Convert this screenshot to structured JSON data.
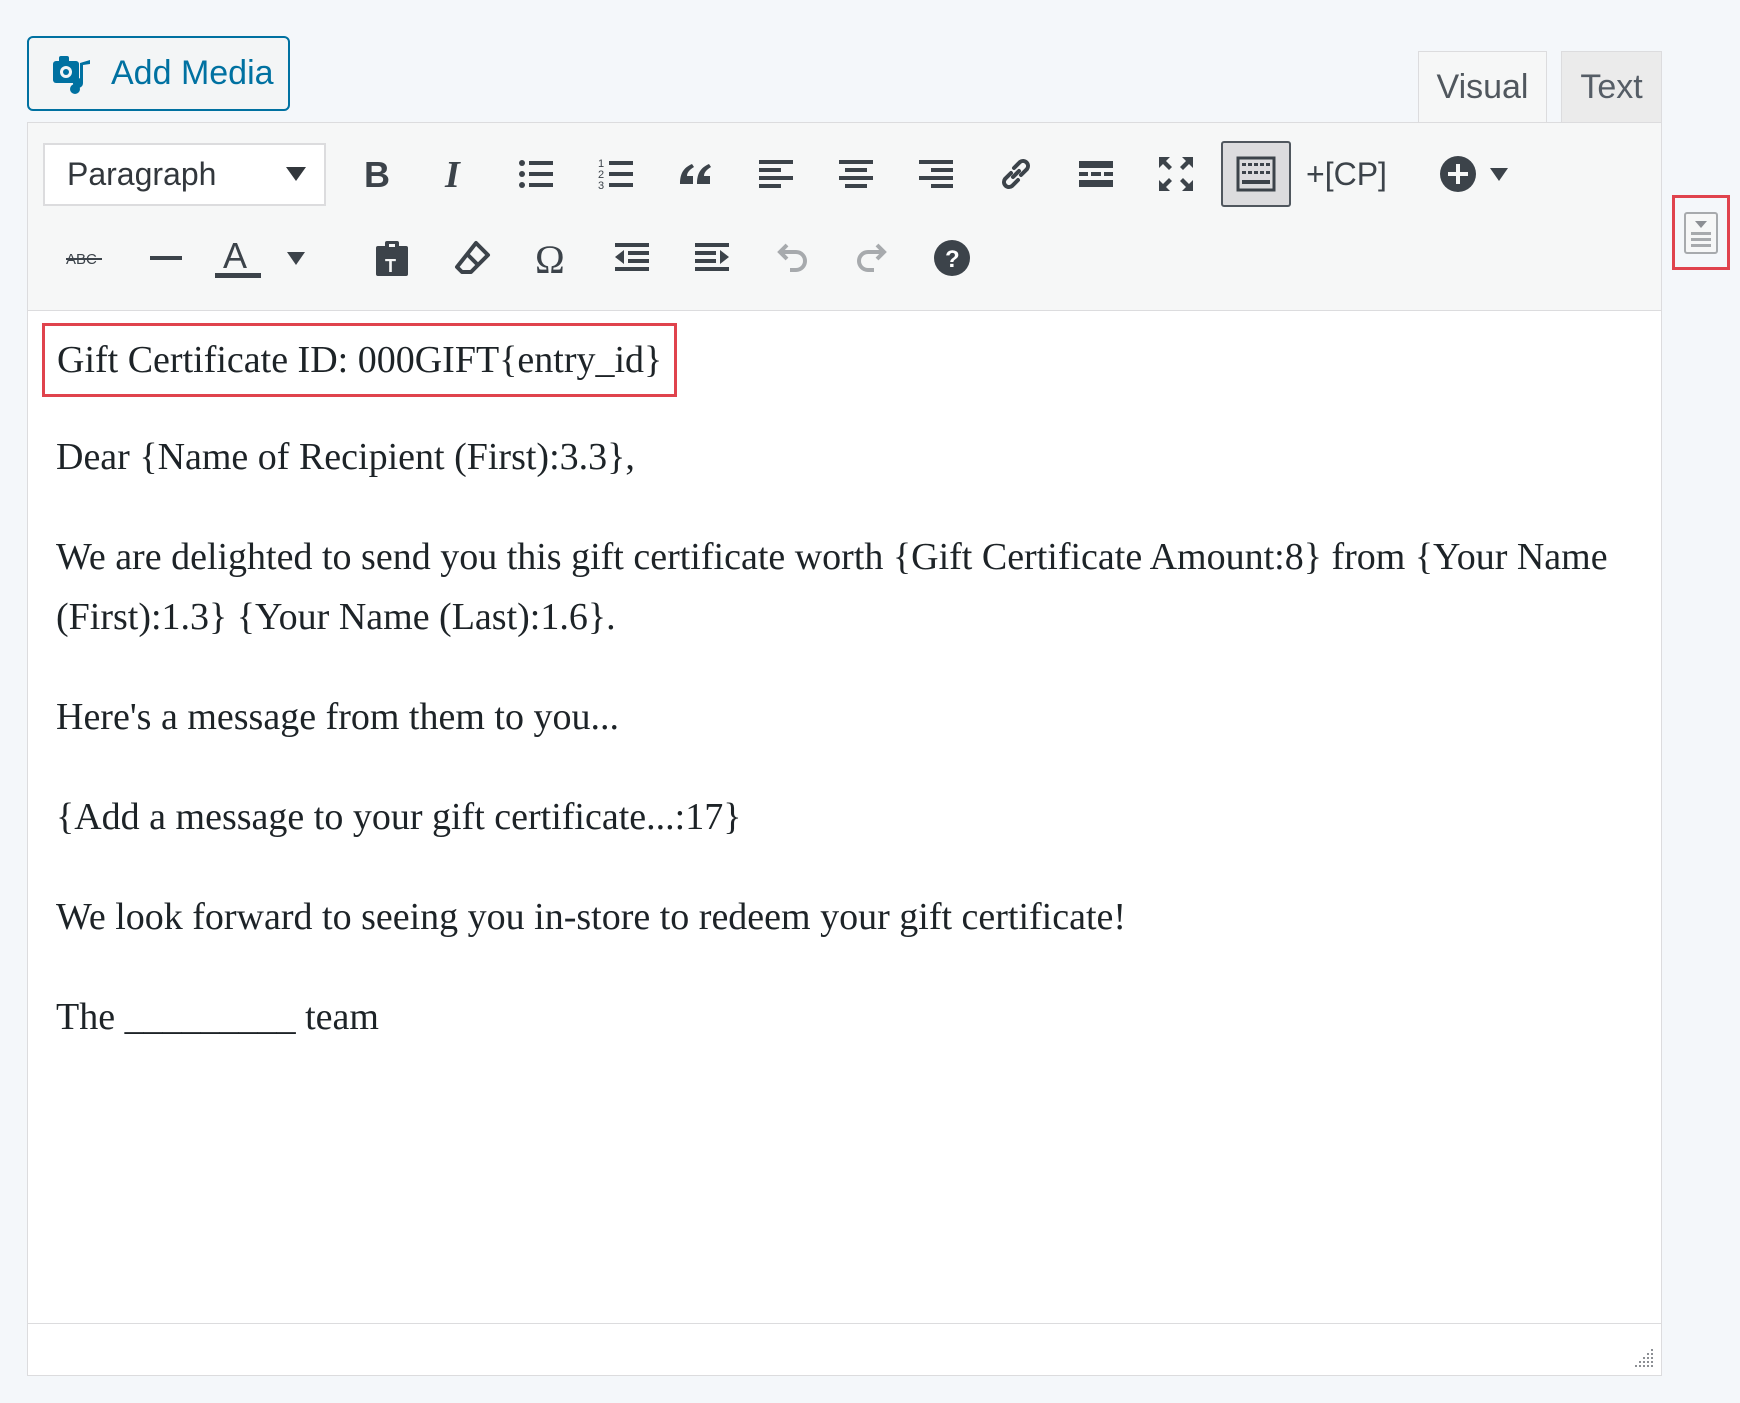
{
  "media": {
    "add_media_label": "Add Media"
  },
  "tabs": [
    {
      "label": "Visual",
      "active": true
    },
    {
      "label": "Text",
      "active": false
    }
  ],
  "toolbar": {
    "format_select_value": "Paragraph",
    "cp_label": "+[CP]",
    "row1_icons": [
      "bold-icon",
      "italic-icon",
      "bulleted-list-icon",
      "numbered-list-icon",
      "blockquote-icon",
      "align-left-icon",
      "align-center-icon",
      "align-right-icon",
      "link-icon",
      "read-more-icon",
      "fullscreen-icon",
      "toolbar-toggle-icon",
      "cp-button",
      "add-block-icon"
    ],
    "row2_icons": [
      "strikethrough-icon",
      "horizontal-line-icon",
      "text-color-icon",
      "paste-text-icon",
      "clear-formatting-icon",
      "special-character-icon",
      "outdent-icon",
      "indent-icon",
      "undo-icon",
      "redo-icon",
      "help-icon"
    ]
  },
  "content": {
    "lines": [
      "Gift Certificate ID: 000GIFT{entry_id}",
      "Dear {Name of Recipient (First):3.3},",
      "We are delighted to send you this gift certificate worth {Gift Certificate Amount:8} from {Your Name (First):1.3} {Your Name (Last):1.6}.",
      "Here's a message from them to you...",
      "{Add a message to your gift certificate...:17}",
      "We look forward to seeing you in-store to redeem your gift certificate!",
      "The _________ team"
    ]
  },
  "colors": {
    "accent": "#0071a1",
    "highlight_border": "#e0434d"
  }
}
